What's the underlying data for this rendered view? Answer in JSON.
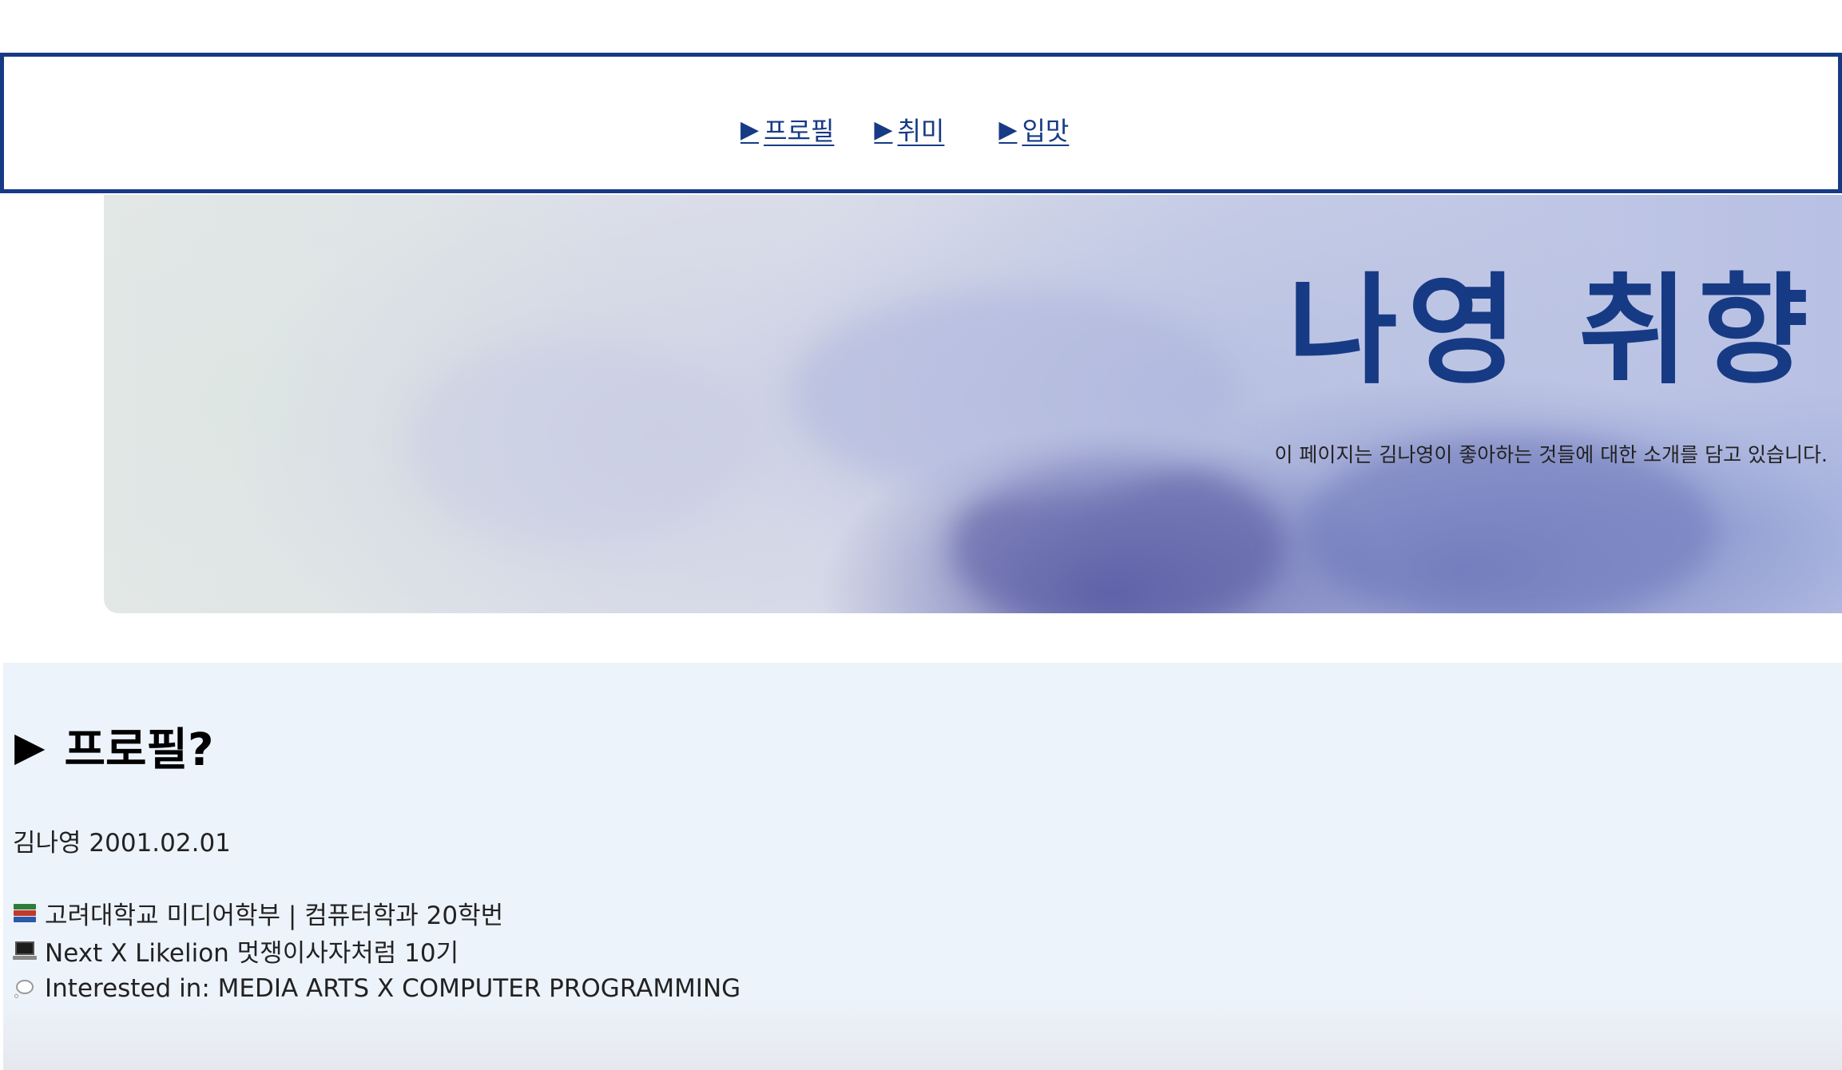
{
  "nav": {
    "links": [
      {
        "arrow": "▶",
        "label": "프로필"
      },
      {
        "arrow": "▶",
        "label": "취미"
      },
      {
        "arrow": "▶",
        "label": "입맛"
      }
    ]
  },
  "hero": {
    "title": "나영 취향",
    "subtitle": "이 페이지는 김나영이 좋아하는 것들에 대한 소개를 담고 있습니다."
  },
  "profile": {
    "heading_arrow": "▶",
    "heading": "프로필?",
    "name_line": "김나영 2001.02.01",
    "items": [
      {
        "icon": "books-icon",
        "text": "고려대학교 미디어학부 | 컴퓨터학과 20학번"
      },
      {
        "icon": "laptop-icon",
        "text": "Next X Likelion 멋쟁이사자처럼 10기"
      },
      {
        "icon": "thought-bubble-icon",
        "text": "Interested in: MEDIA ARTS X COMPUTER PROGRAMMING"
      }
    ]
  },
  "colors": {
    "accent": "#173a85",
    "section_background": "#edf3fb"
  }
}
